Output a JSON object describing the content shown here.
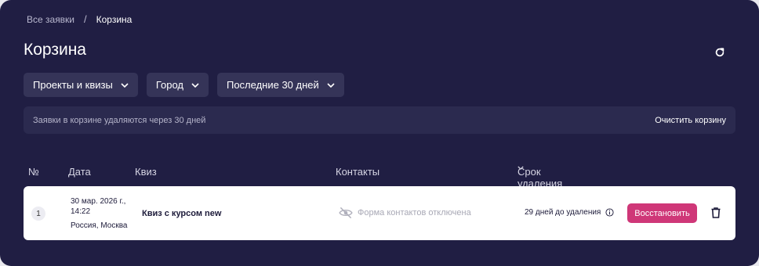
{
  "breadcrumb": {
    "parent": "Все заявки",
    "separator": "/",
    "current": "Корзина"
  },
  "page_title": "Корзина",
  "filters": [
    {
      "label": "Проекты и квизы"
    },
    {
      "label": "Город"
    },
    {
      "label": "Последние 30 дней"
    }
  ],
  "info_bar": {
    "text": "Заявки в корзине удаляются через 30 дней",
    "action": "Очистить корзину"
  },
  "table": {
    "columns": {
      "num": "№",
      "date": "Дата",
      "quiz": "Квиз",
      "contacts": "Контакты",
      "deadline": "Срок удаления"
    },
    "rows": [
      {
        "num": "1",
        "date": "30 мар. 2026 г., 14:22",
        "city": "Россия, Москва",
        "quiz": "Квиз с курсом new",
        "contacts": "Форма контактов отключена",
        "deadline": "29 дней до удаления",
        "restore": "Восстановить"
      }
    ]
  },
  "colors": {
    "background": "#201e43",
    "filter": "#353458",
    "info_bar": "#2b2a4f",
    "accent": "#cf3778"
  },
  "icons": [
    "refresh-icon",
    "chevron-down-icon",
    "eye-off-icon",
    "info-icon",
    "trash-icon"
  ]
}
